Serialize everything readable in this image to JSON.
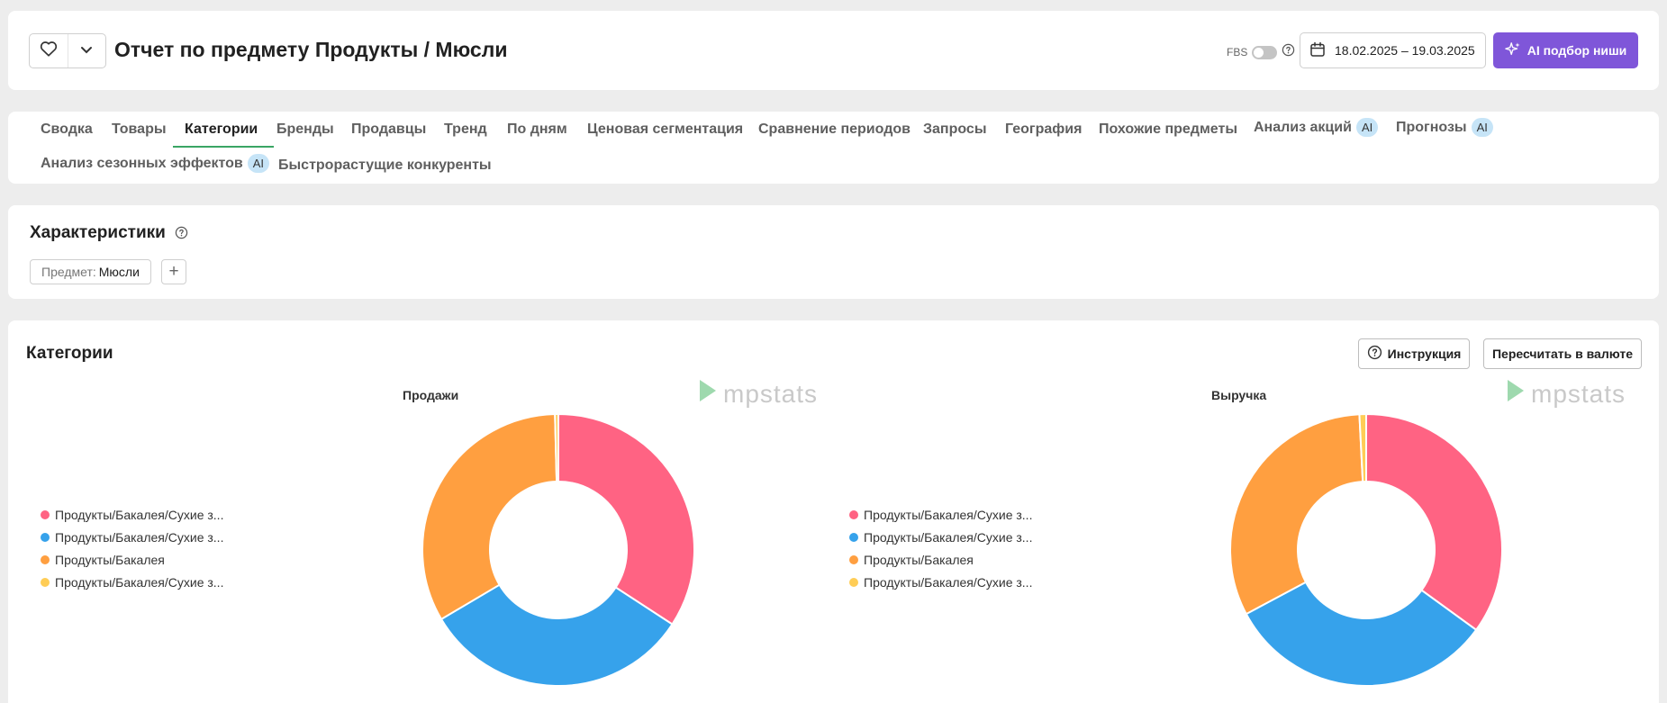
{
  "header": {
    "title": "Отчет по предмету Продукты / Мюсли",
    "fbs_label": "FBS",
    "date_range": "18.02.2025 – 19.03.2025",
    "ai_button": "AI подбор ниши"
  },
  "tabs": [
    {
      "label": "Сводка"
    },
    {
      "label": "Товары"
    },
    {
      "label": "Категории",
      "active": true
    },
    {
      "label": "Бренды"
    },
    {
      "label": "Продавцы"
    },
    {
      "label": "Тренд"
    },
    {
      "label": "По дням"
    },
    {
      "label": "Ценовая сегментация"
    },
    {
      "label": "Сравнение периодов"
    },
    {
      "label": "Запросы"
    },
    {
      "label": "География"
    },
    {
      "label": "Похожие предметы"
    },
    {
      "label": "Анализ акций",
      "badge": "AI"
    },
    {
      "label": "Прогнозы",
      "badge": "AI"
    },
    {
      "label": "Анализ сезонных эффектов",
      "badge": "AI"
    },
    {
      "label": "Быстрорастущие конкуренты"
    }
  ],
  "characteristics": {
    "title": "Характеристики",
    "filter_key": "Предмет:",
    "filter_value": "Мюсли",
    "add_label": "+"
  },
  "categories": {
    "title": "Категории",
    "instruction_button": "Инструкция",
    "recalc_button": "Пересчитать в валюте",
    "watermark": "mpstats"
  },
  "colors": {
    "accent": "#7f56d9",
    "tab_underline": "#3aa564",
    "ai_badge": "#c6e4f7"
  },
  "chart_data": [
    {
      "type": "pie",
      "title": "Продажи",
      "labels": [
        "Продукты/Бакалея/Сухие з...",
        "Продукты/Бакалея/Сухие з...",
        "Продукты/Бакалея",
        "Продукты/Бакалея/Сухие з..."
      ],
      "values": [
        34.2,
        32.3,
        33.1,
        0.4
      ],
      "colors": [
        "#ff6383",
        "#36a2eb",
        "#ff9f40",
        "#ffcd56"
      ],
      "legend": "left"
    },
    {
      "type": "pie",
      "title": "Выручка",
      "labels": [
        "Продукты/Бакалея/Сухие з...",
        "Продукты/Бакалея/Сухие з...",
        "Продукты/Бакалея",
        "Продукты/Бакалея/Сухие з..."
      ],
      "values": [
        35.0,
        32.2,
        32.0,
        0.8
      ],
      "colors": [
        "#ff6383",
        "#36a2eb",
        "#ff9f40",
        "#ffcd56"
      ],
      "legend": "left"
    }
  ]
}
